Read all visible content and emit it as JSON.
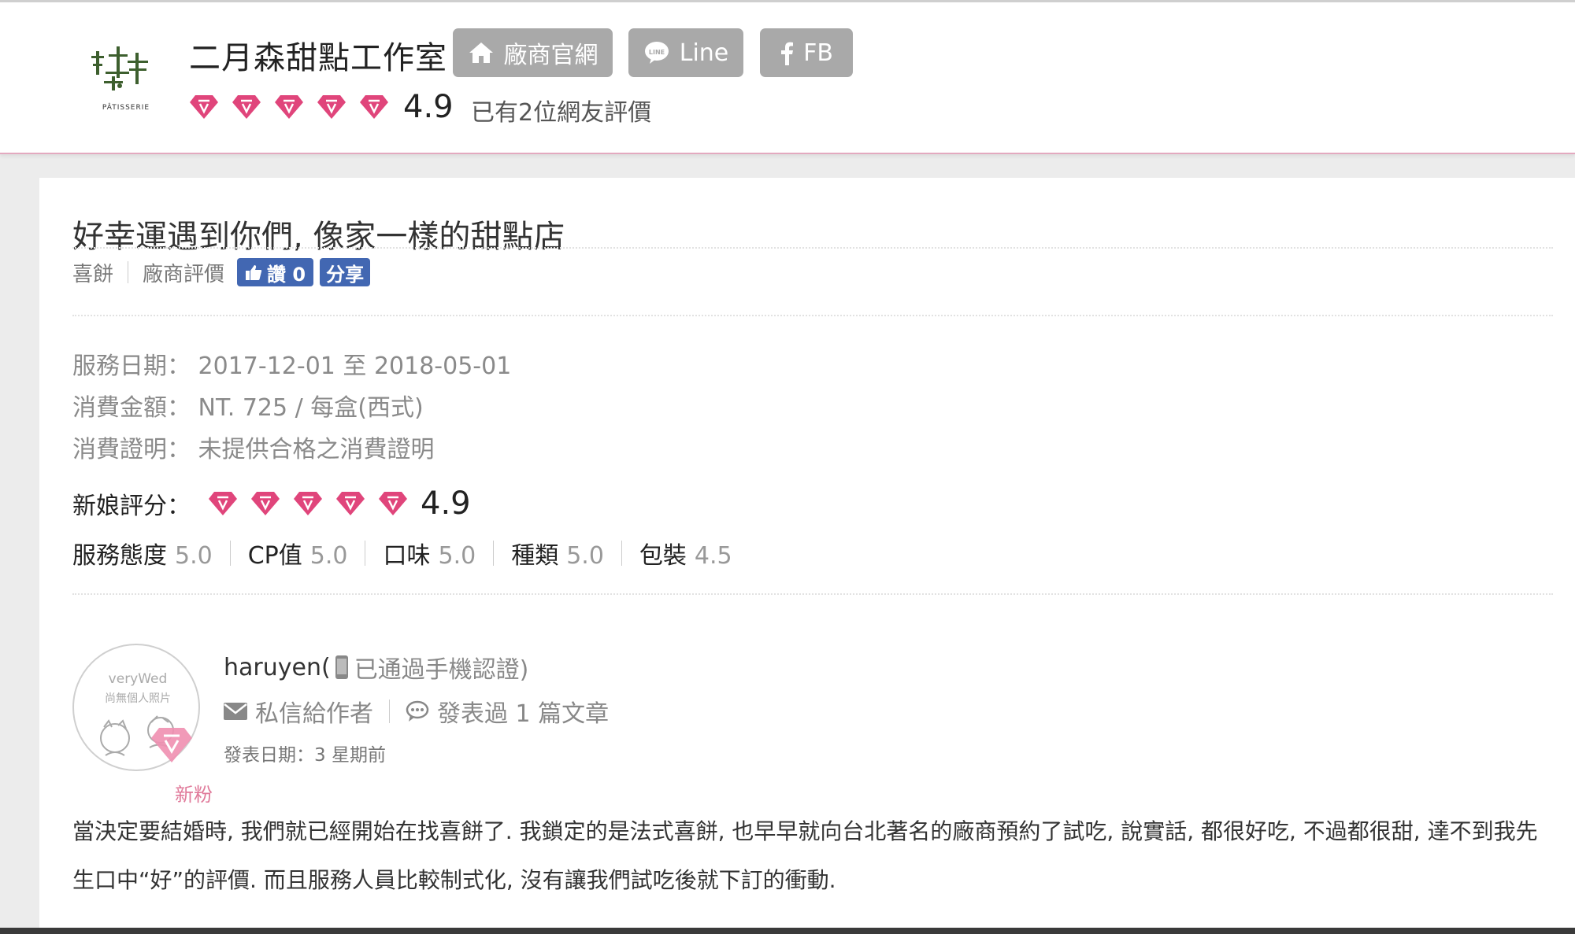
{
  "header": {
    "vendor_name": "二月森甜點工作室",
    "logo_text": "PÂTISSERIE",
    "buttons": {
      "home": "廠商官網",
      "line": "Line",
      "fb": "FB"
    },
    "rating": {
      "score": "4.9",
      "diamonds": 5
    },
    "review_count_text": "已有2位網友評價"
  },
  "review": {
    "title": "好幸運遇到你們, 像家一樣的甜點店",
    "category": "喜餅",
    "type": "廠商評價",
    "like_label": "讚 0",
    "share_label": "分享",
    "service_date": "服務日期： 2017-12-01  至 2018-05-01",
    "amount": "消費金額： NT. 725 / 每盒(西式)",
    "proof": "消費證明： 未提供合格之消費證明",
    "bride_rating_label": "新娘評分：",
    "bride_rating_score": "4.9",
    "sub_scores": [
      {
        "label": "服務態度",
        "value": "5.0"
      },
      {
        "label": "CP值",
        "value": "5.0"
      },
      {
        "label": "口味",
        "value": "5.0"
      },
      {
        "label": "種類",
        "value": "5.0"
      },
      {
        "label": "包裝",
        "value": "4.5"
      }
    ],
    "body": "當決定要結婚時, 我們就已經開始在找喜餅了. 我鎖定的是法式喜餅, 也早早就向台北著名的廠商預約了試吃, 說實話, 都很好吃, 不過都很甜, 達不到我先生口中“好”的評價. 而且服務人員比較制式化, 沒有讓我們試吃後就下訂的衝動."
  },
  "author": {
    "name": "haruyen(",
    "phone_note": "已通過手機認證)",
    "avatar_text_1": "veryWed",
    "avatar_text_2": "尚無個人照片",
    "fan_label": "新粉",
    "message_label": "私信給作者",
    "posts_label": "發表過 1 篇文章",
    "post_date": "發表日期：3 星期前"
  },
  "colors": {
    "diamond": "#e0457b",
    "header_button": "#a9a9a9",
    "facebook": "#4267b2",
    "header_border": "#e3a9bf"
  }
}
